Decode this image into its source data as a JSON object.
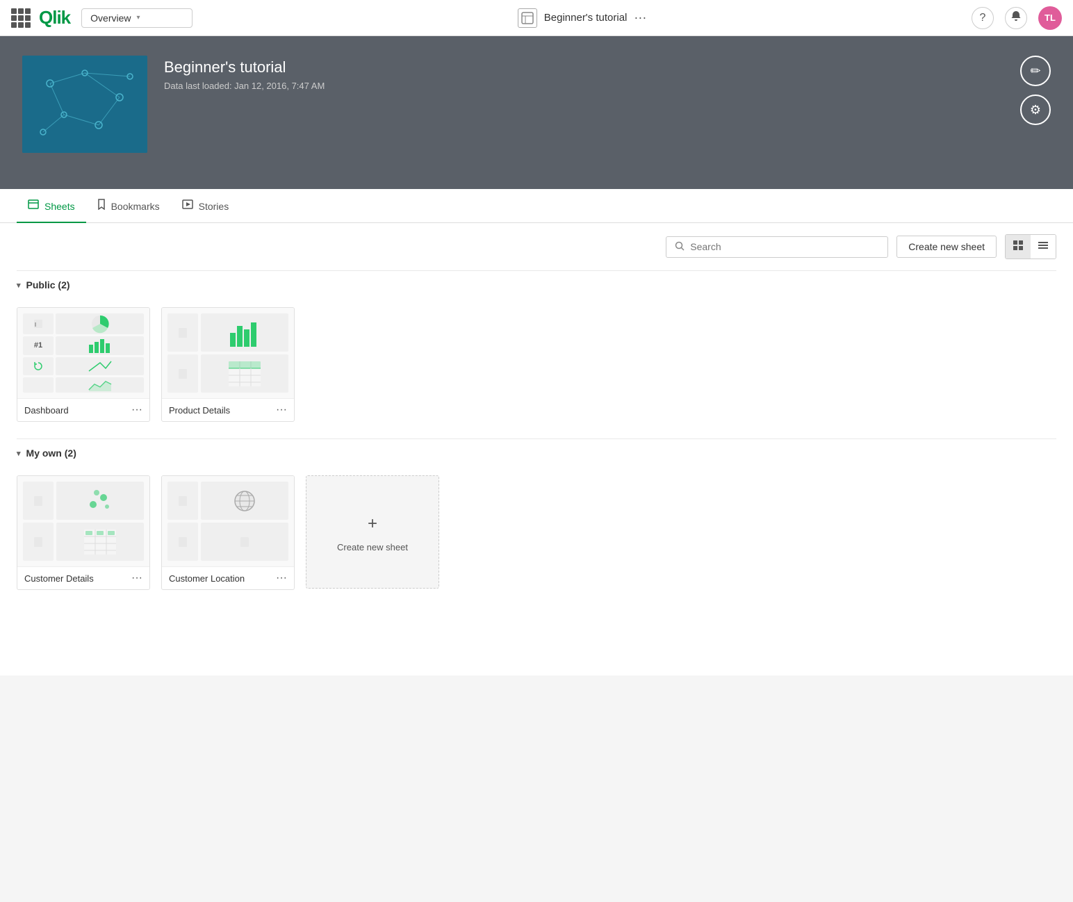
{
  "nav": {
    "grid_label": "apps menu",
    "logo": "Qlik",
    "dropdown_value": "Overview",
    "app_title": "Beginner's tutorial",
    "app_more": "···",
    "help_icon": "?",
    "bell_icon": "🔔",
    "avatar_initials": "TL"
  },
  "hero": {
    "title": "Beginner's tutorial",
    "subtitle": "Data last loaded: Jan 12, 2016, 7:47 AM",
    "edit_icon": "✏",
    "settings_icon": "⚙"
  },
  "tabs": [
    {
      "id": "sheets",
      "label": "Sheets",
      "active": true
    },
    {
      "id": "bookmarks",
      "label": "Bookmarks",
      "active": false
    },
    {
      "id": "stories",
      "label": "Stories",
      "active": false
    }
  ],
  "toolbar": {
    "search_placeholder": "Search",
    "create_btn_label": "Create new sheet",
    "grid_view_icon": "⊞",
    "list_view_icon": "≡"
  },
  "sections": [
    {
      "id": "public",
      "label": "Public (2)",
      "expanded": true,
      "sheets": [
        {
          "id": "dashboard",
          "title": "Dashboard",
          "type": "dashboard"
        },
        {
          "id": "product-details",
          "title": "Product Details",
          "type": "product"
        }
      ]
    },
    {
      "id": "my-own",
      "label": "My own (2)",
      "expanded": true,
      "sheets": [
        {
          "id": "customer-details",
          "title": "Customer Details",
          "type": "customer-details"
        },
        {
          "id": "customer-location",
          "title": "Customer Location",
          "type": "customer-location"
        }
      ],
      "show_create": true
    }
  ],
  "create_new_sheet": "Create new sheet",
  "icons": {
    "chevron_down": "▾",
    "chevron_up": "▴",
    "more": "···",
    "search": "🔍",
    "plus": "+",
    "sheet": "⬜",
    "bookmark": "🔖",
    "story": "▶"
  },
  "colors": {
    "green": "#2ecc6e",
    "teal": "#009845",
    "hero_bg": "#5a6068"
  }
}
